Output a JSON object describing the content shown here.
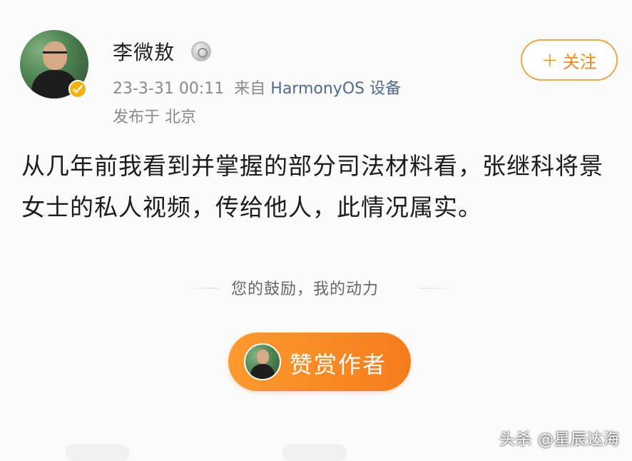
{
  "post": {
    "username": "李微敖",
    "timestamp": "23-3-31 00:11",
    "source_prefix": "来自",
    "device": "HarmonyOS 设备",
    "location": "发布于 北京",
    "follow_plus": "+",
    "follow_label": "关注",
    "content": "从几年前我看到并掌握的部分司法材料看，张继科将景女士的私人视频，传给他人，此情况属实。"
  },
  "reward": {
    "encourage_text": "您的鼓励，我的动力",
    "button_label": "赞赏作者"
  },
  "watermark": "头杀 @星辰达海",
  "colors": {
    "accent": "#f7891f",
    "follow_border": "#f0a64a",
    "device_link": "#51698c",
    "badge": "#f4b30b"
  },
  "icons": {
    "verified_badge": "verified-badge-icon",
    "medal": "medal-icon"
  }
}
